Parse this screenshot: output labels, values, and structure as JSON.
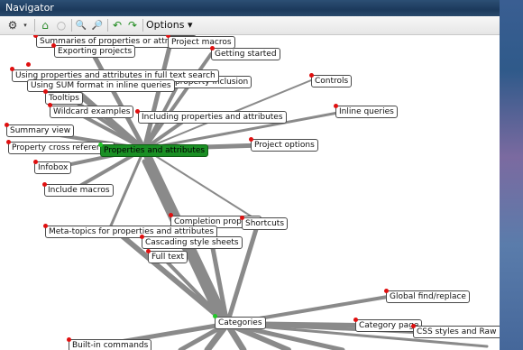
{
  "window": {
    "title": "Navigator"
  },
  "toolbar": {
    "options_label": "Options",
    "options_arrow": "▾",
    "icons": {
      "layout": "⚙",
      "home": "⌂",
      "stop": "○",
      "zoom_in": "🔍",
      "zoom_out": "🔎",
      "undo": "↶",
      "redo": "↷"
    }
  },
  "nodes": {
    "summaries": "Summaries of properties or attributes",
    "project_macros": "Project macros",
    "exporting_projects": "Exporting projects",
    "getting_started": "Getting started",
    "using_props_fulltext": "Using properties and attributes in full text search",
    "using_sum": "Using SUM format in inline queries",
    "property_inclusion": "Using property inclusion",
    "controls": "Controls",
    "tooltips": "Tooltips",
    "wildcard": "Wildcard examples",
    "including_props": "Including properties and attributes",
    "inline_queries": "Inline queries",
    "summary_view": "Summary view",
    "property_cross_ref": "Property cross reference",
    "properties_and_attributes": "Properties and attributes",
    "project_options": "Project options",
    "infobox": "Infobox",
    "include_macros": "Include macros",
    "completion_proposal": "Completion proposal",
    "shortcuts": "Shortcuts",
    "meta_topics": "Meta-topics for properties and attributes",
    "cascading_css": "Cascading style sheets",
    "full_text": "Full text",
    "global_find": "Global find/replace",
    "categories": "Categories",
    "category_page": "Category page",
    "css_styles": "CSS styles and Raw HTML",
    "builtin_commands": "Built-in commands"
  }
}
